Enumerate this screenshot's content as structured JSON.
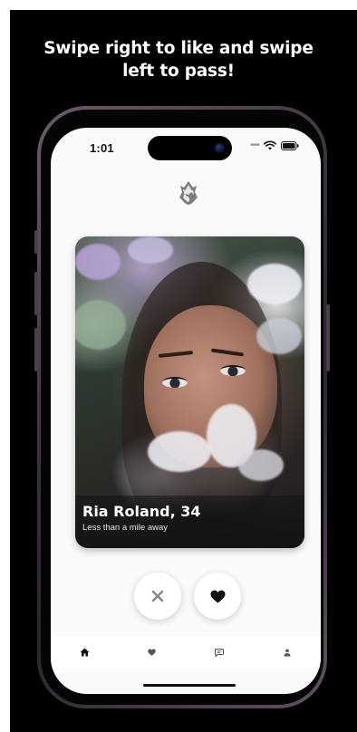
{
  "headline": {
    "line1": "Swipe right to like and swipe",
    "line2": "left to pass!"
  },
  "status_bar": {
    "time": "1:01",
    "icons": [
      "signal-dots-icon",
      "wifi-icon",
      "battery-icon"
    ]
  },
  "logo": {
    "icon": "fox-logo-icon"
  },
  "profile_card": {
    "name_age": "Ria Roland, 34",
    "distance": "Less than a mile away"
  },
  "actions": {
    "pass_icon": "close-icon",
    "like_icon": "heart-icon"
  },
  "tab_bar": {
    "items": [
      {
        "icon": "home-icon",
        "active": true
      },
      {
        "icon": "heart-icon",
        "active": false
      },
      {
        "icon": "chat-icon",
        "active": false
      },
      {
        "icon": "person-icon",
        "active": false
      }
    ]
  },
  "colors": {
    "background": "#000000",
    "screen": "#fafafa",
    "text_primary": "#111111",
    "tab_inactive": "#555555"
  }
}
